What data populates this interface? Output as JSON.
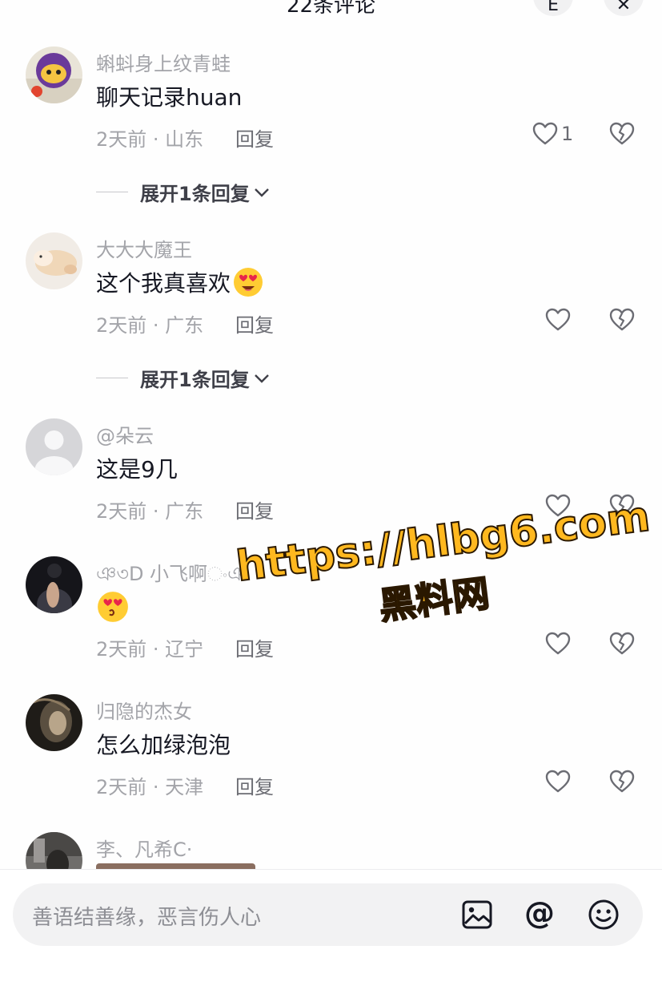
{
  "header": {
    "title": "22条评论",
    "left_button_glyph": "E",
    "close_glyph": "✕"
  },
  "comments": [
    {
      "username": "蝌蚪身上纹青蛙",
      "text": "聊天记录huan",
      "emoji": "",
      "time_location": "2天前 · 山东",
      "reply_label": "回复",
      "like_count": "1",
      "expand_label": "展开1条回复"
    },
    {
      "username": "大大大魔王",
      "text": "这个我真喜欢",
      "emoji": "😍",
      "time_location": "2天前 · 广东",
      "reply_label": "回复",
      "like_count": "",
      "expand_label": "展开1条回复"
    },
    {
      "username": "@朵云",
      "text": "这是9几",
      "emoji": "",
      "time_location": "2天前 · 广东",
      "reply_label": "回复",
      "like_count": "",
      "expand_label": ""
    },
    {
      "username": "ঞ৩D 小飞啊ංঞ",
      "text": "",
      "emoji": "😍",
      "time_location": "2天前 · 辽宁",
      "reply_label": "回复",
      "like_count": "",
      "expand_label": ""
    },
    {
      "username": "归隐的杰女",
      "text": "怎么加绿泡泡",
      "emoji": "",
      "time_location": "2天前 · 天津",
      "reply_label": "回复",
      "like_count": "",
      "expand_label": ""
    },
    {
      "username": "李、凡希C·",
      "text": "",
      "emoji": "",
      "time_location": "",
      "reply_label": "",
      "like_count": "",
      "expand_label": ""
    }
  ],
  "watermark": {
    "url": "https://hlbg6.com",
    "name": "黑料网",
    "color": "#ffb81f"
  },
  "input": {
    "placeholder": "善语结善缘，恶言伤人心",
    "icons": [
      "image-icon",
      "at-icon",
      "emoji-icon"
    ],
    "at_glyph": "@"
  }
}
